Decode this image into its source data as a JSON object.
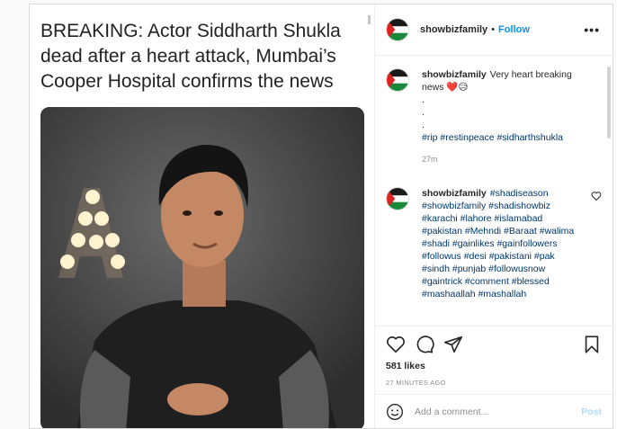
{
  "post": {
    "headline": "BREAKING: Actor Siddharth Shukla dead after a heart attack, Mumbai’s Cooper Hospital confirms the news",
    "photo_sign": "A"
  },
  "header": {
    "username": "showbizfamily",
    "separator": "•",
    "follow_label": "Follow",
    "more_label": "•••"
  },
  "caption": {
    "username": "showbizfamily",
    "text": "Very heart breaking news ❤️😥",
    "dots": [
      ".",
      ".",
      "."
    ],
    "hashtags": "#rip #restinpeace #sidharthshukla",
    "time": "27m"
  },
  "comment": {
    "username": "showbizfamily",
    "hashtags": "#shadiseason #showbizfamily #shadishowbiz #karachi #lahore #islamabad #pakistan #Mehndi #Baraat #walima #shadi #gainlikes #gainfollowers #followus #desi #pakistani #pak #sindh #punjab #followusnow #gaintrick #comment #blessed #mashaallah #mashallah"
  },
  "actions": {
    "likes": "581 likes",
    "time_ago": "27 MINUTES AGO"
  },
  "add_comment": {
    "placeholder": "Add a comment...",
    "post_label": "Post"
  },
  "colors": {
    "link": "#0095f6",
    "hashtag": "#00376b",
    "muted": "#8e8e8e"
  }
}
